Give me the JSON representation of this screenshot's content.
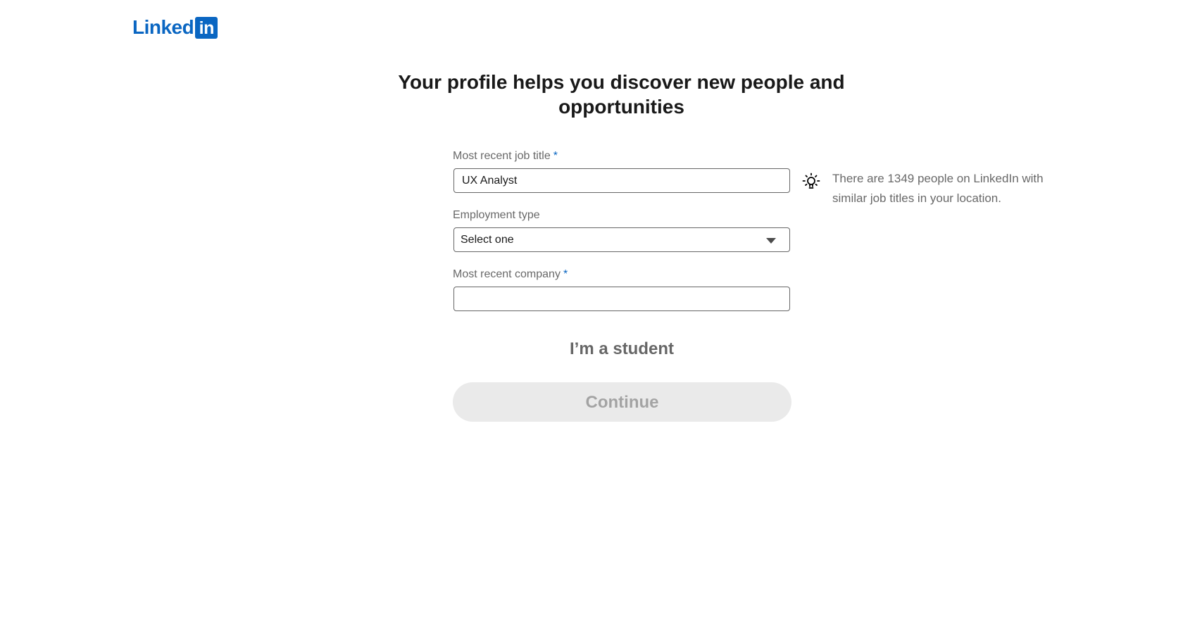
{
  "brand": {
    "logo_text": "Linked",
    "logo_box": "in",
    "color": "#0a66c2"
  },
  "heading": "Your profile helps you discover new people and opportunities",
  "form": {
    "job_title": {
      "label": "Most recent job title",
      "required_mark": "*",
      "value": "UX Analyst"
    },
    "employment_type": {
      "label": "Employment type",
      "selected": "Select one"
    },
    "company": {
      "label": "Most recent company",
      "required_mark": "*",
      "value": ""
    }
  },
  "hint": {
    "icon": "lightbulb-icon",
    "text": "There are 1349 people on LinkedIn with similar job titles in your location."
  },
  "student_link": "I’m a student",
  "continue_label": "Continue"
}
